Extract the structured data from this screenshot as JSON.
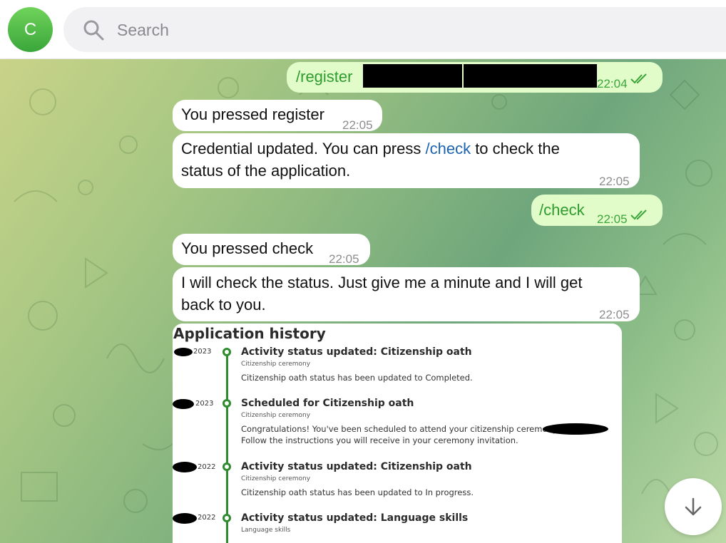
{
  "header": {
    "avatar_letter": "C",
    "search_placeholder": "Search"
  },
  "messages": [
    {
      "direction": "out",
      "text": "/register",
      "time": "22:04",
      "status": "read"
    },
    {
      "direction": "in",
      "text": "You pressed register",
      "time": "22:05"
    },
    {
      "direction": "in",
      "text_before": "Credential updated. You can press ",
      "link": "/check",
      "text_after_1": " to check the",
      "text_after_2": "status of the application.",
      "time": "22:05"
    },
    {
      "direction": "out",
      "text": "/check",
      "time": "22:05",
      "status": "read"
    },
    {
      "direction": "in",
      "text": "You pressed check",
      "time": "22:05"
    },
    {
      "direction": "in",
      "line1": "I will check the status. Just give me a minute and I will get",
      "line2": "back to you.",
      "time": "22:05"
    }
  ],
  "application_history": {
    "title": "Application history",
    "entries": [
      {
        "date": "2023",
        "heading": "Activity status updated: Citizenship oath",
        "category": "Citizenship ceremony",
        "description": "Citizenship oath status has been updated to Completed."
      },
      {
        "date": "2023",
        "heading": "Scheduled for Citizenship oath",
        "category": "Citizenship ceremony",
        "description_line1": "Congratulations! You've been scheduled to attend your citizenship ceremony on",
        "description_line2": "Follow the instructions you will receive in your ceremony invitation."
      },
      {
        "date": "2022",
        "heading": "Activity status updated: Citizenship oath",
        "category": "Citizenship ceremony",
        "description": "Citizenship oath status has been updated to In progress."
      },
      {
        "date": "2022",
        "heading": "Activity status updated: Language skills",
        "category": "Language skills"
      }
    ]
  },
  "colors": {
    "outgoing_bubble": "#e2fcc9",
    "outgoing_text": "#2e9c2e",
    "incoming_bubble": "#ffffff",
    "link": "#1c63b1",
    "timeline": "#2e8b2e"
  },
  "icons": [
    "search-icon",
    "double-check-icon",
    "arrow-down-icon"
  ]
}
